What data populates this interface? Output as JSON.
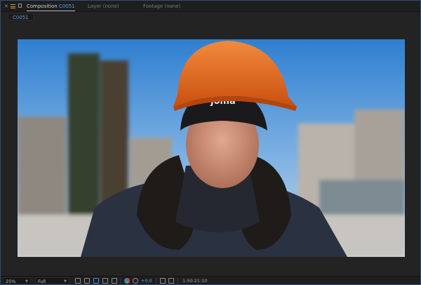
{
  "tabs": {
    "composition_label": "Composition",
    "composition_name": "C0051",
    "layer": "Layer (none)",
    "footage": "Footage (none)"
  },
  "breadcrumb": {
    "comp": "C0051"
  },
  "toolbar": {
    "zoom": "25%",
    "resolution": "Full",
    "exposure": "+0,0",
    "timecode": "1:50:21:10"
  },
  "colors": {
    "accent": "#5aa0ea",
    "panel": "#232323",
    "helmet": "#e2651e"
  },
  "icons": [
    "close-icon",
    "panel-menu-icon",
    "lock-icon",
    "chevron-down-icon",
    "toggle-mask-icon",
    "grid-icon",
    "transparency-icon",
    "region-of-interest-icon",
    "channels-icon",
    "reset-exposure-icon",
    "snapshot-icon",
    "show-snapshot-icon"
  ]
}
